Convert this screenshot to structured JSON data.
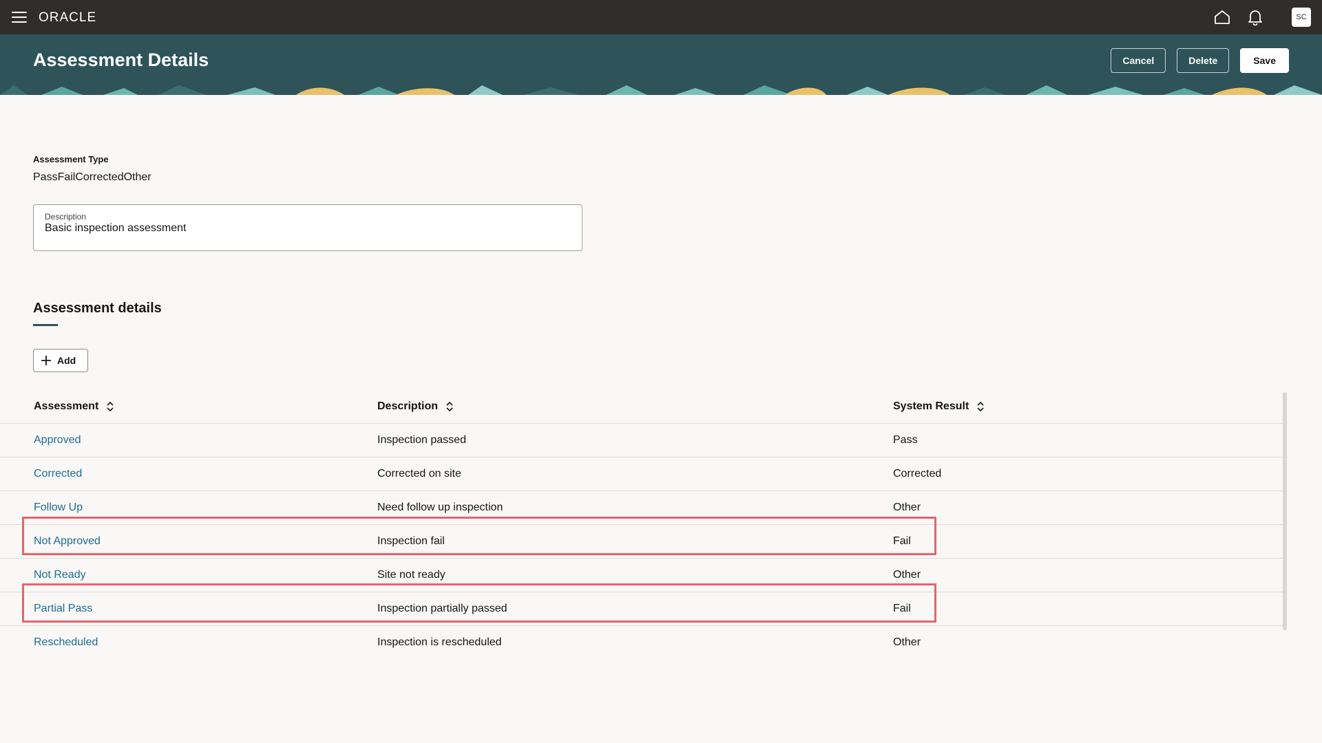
{
  "topbar": {
    "logo": "ORACLE",
    "avatar_initials": "SC",
    "icons": [
      "menu-icon",
      "home-icon",
      "bell-icon"
    ]
  },
  "header": {
    "title": "Assessment Details",
    "cancel_label": "Cancel",
    "delete_label": "Delete",
    "save_label": "Save"
  },
  "form": {
    "assessment_type_label": "Assessment Type",
    "assessment_type_value": "PassFailCorrectedOther",
    "description_label": "Description",
    "description_value": "Basic inspection assessment"
  },
  "details": {
    "section_title": "Assessment details",
    "add_label": "Add",
    "columns": [
      "Assessment",
      "Description",
      "System Result"
    ],
    "rows": [
      {
        "assessment": "Approved",
        "description": "Inspection passed",
        "result": "Pass"
      },
      {
        "assessment": "Corrected",
        "description": "Corrected on site",
        "result": "Corrected"
      },
      {
        "assessment": "Follow Up",
        "description": "Need follow up inspection",
        "result": "Other"
      },
      {
        "assessment": "Not Approved",
        "description": "Inspection fail",
        "result": "Fail"
      },
      {
        "assessment": "Not Ready",
        "description": "Site not ready",
        "result": "Other"
      },
      {
        "assessment": "Partial Pass",
        "description": "Inspection partially passed",
        "result": "Fail"
      },
      {
        "assessment": "Rescheduled",
        "description": "Inspection is rescheduled",
        "result": "Other"
      }
    ]
  },
  "colors": {
    "topbar": "#312d2a",
    "banner": "#2e5359",
    "link": "#1e6a96",
    "highlight": "#e8626a"
  }
}
